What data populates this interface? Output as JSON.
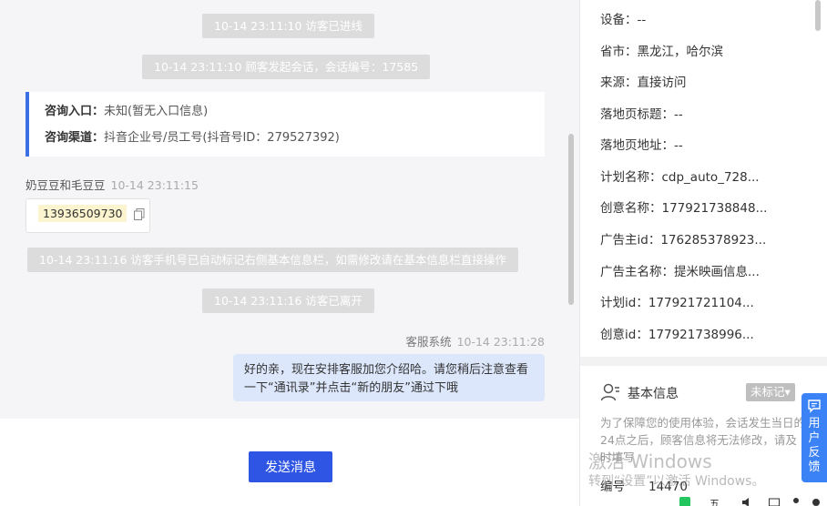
{
  "chat": {
    "system_messages": [
      "10-14 23:11:10 访客已进线",
      "10-14 23:11:10 顾客发起会话，会话编号：17585",
      "10-14 23:11:16 访客手机号已自动标记右侧基本信息栏，如需修改请在基本信息栏直接操作",
      "10-14 23:11:16 访客已离开"
    ],
    "info_card": {
      "entry_label": "咨询入口：",
      "entry_value": "未知(暂无入口信息)",
      "channel_label": "咨询渠道：",
      "channel_value": "抖音企业号/员工号(抖音号ID：279527392)"
    },
    "visitor": {
      "name": "奶豆豆和毛豆豆",
      "time": "10-14 23:11:15",
      "phone": "13936509730"
    },
    "agent": {
      "name": "客服系统",
      "time": "10-14 23:11:28",
      "message": "好的亲，现在安排客服加您介绍哈。请您稍后注意查看一下“通讯录”并点击“新的朋友”通过下哦"
    },
    "send_label": "发送消息"
  },
  "side": {
    "fields": [
      "设备：--",
      "省市：黑龙江，哈尔滨",
      "来源：直接访问",
      "落地页标题：--",
      "落地页地址：--",
      "计划名称：cdp_auto_728...",
      "创意名称：177921738848...",
      "广告主id：176285378923...",
      "广告主名称：提米映画信息...",
      "计划id：177921721104...",
      "创意id：177921738996..."
    ],
    "basic_info_title": "基本信息",
    "tag_dropdown": "未标记▾",
    "notice": "为了保障您的使用体验，会话发生当日的24点之后，顾客信息将无法修改，请及时填写",
    "id_label": "编号",
    "id_value": "14470"
  },
  "watermark": {
    "line1": "激活 Windows",
    "line2": "转到“设置”以激活 Windows。"
  },
  "feedback_label": "用户反馈",
  "colors": {
    "accent": "#2f55e4",
    "agent_bubble": "#dce7fb",
    "card_border": "#3b6fe4",
    "feedback": "#3b82f6"
  }
}
